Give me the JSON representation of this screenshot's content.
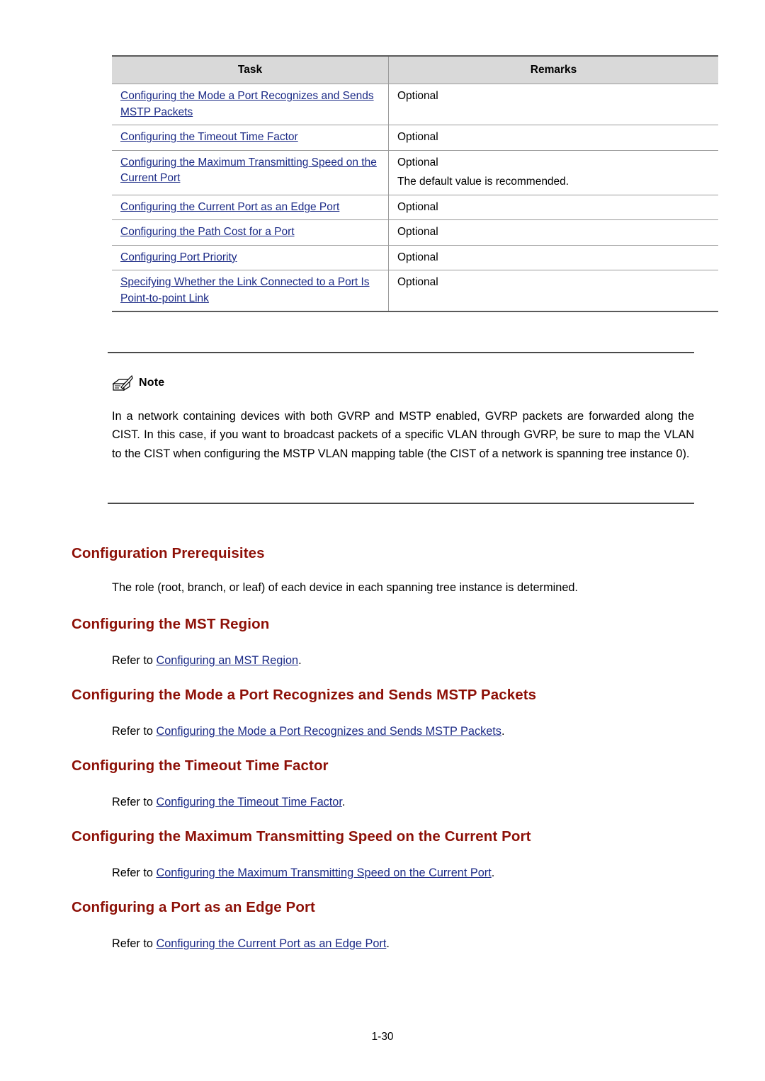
{
  "table": {
    "headers": [
      "Task",
      "Remarks"
    ],
    "rows": [
      {
        "task": "Configuring the Mode a Port Recognizes and Sends MSTP Packets",
        "remarks": [
          "Optional"
        ]
      },
      {
        "task": "Configuring the Timeout Time Factor",
        "remarks": [
          "Optional"
        ]
      },
      {
        "task": "Configuring the Maximum Transmitting Speed on the Current Port",
        "remarks": [
          "Optional",
          "The default value is recommended."
        ]
      },
      {
        "task": "Configuring the Current Port as an Edge Port",
        "remarks": [
          "Optional"
        ]
      },
      {
        "task": "Configuring the Path Cost for a Port",
        "remarks": [
          "Optional"
        ]
      },
      {
        "task": "Configuring Port Priority",
        "remarks": [
          "Optional"
        ]
      },
      {
        "task": "Specifying Whether the Link Connected to a Port Is Point-to-point Link",
        "remarks": [
          "Optional"
        ]
      }
    ]
  },
  "note": {
    "label": "Note",
    "body": "In a network containing devices with both GVRP and MSTP enabled, GVRP packets are forwarded along the CIST. In this case, if you want to broadcast packets of a specific VLAN through GVRP, be sure to map the VLAN to the CIST when configuring the MSTP VLAN mapping table (the CIST of a network is spanning tree instance 0)."
  },
  "sections": [
    {
      "heading": "Configuration Prerequisites",
      "body_prefix": "The role (root, branch, or leaf) of each device in each spanning tree instance is determined.",
      "link": "",
      "body_suffix": ""
    },
    {
      "heading": "Configuring the MST Region",
      "body_prefix": "Refer to ",
      "link": "Configuring an MST Region",
      "body_suffix": "."
    },
    {
      "heading": "Configuring the Mode a Port Recognizes and Sends MSTP Packets",
      "body_prefix": "Refer to ",
      "link": "Configuring the Mode a Port Recognizes and Sends MSTP Packets",
      "body_suffix": "."
    },
    {
      "heading": "Configuring the Timeout Time Factor",
      "body_prefix": "Refer to ",
      "link": "Configuring the Timeout Time Factor",
      "body_suffix": "."
    },
    {
      "heading": "Configuring the Maximum Transmitting Speed on the Current Port",
      "body_prefix": "Refer to ",
      "link": "Configuring the Maximum Transmitting Speed on the Current Port",
      "body_suffix": "."
    },
    {
      "heading": "Configuring a Port as an Edge Port",
      "body_prefix": "Refer to ",
      "link": "Configuring the Current Port as an Edge Port",
      "body_suffix": "."
    }
  ],
  "footer": {
    "page_number": "1-30"
  },
  "colors": {
    "heading": "#8d1007",
    "link": "#1b2a86",
    "table_header_bg": "#d9d9d9"
  }
}
